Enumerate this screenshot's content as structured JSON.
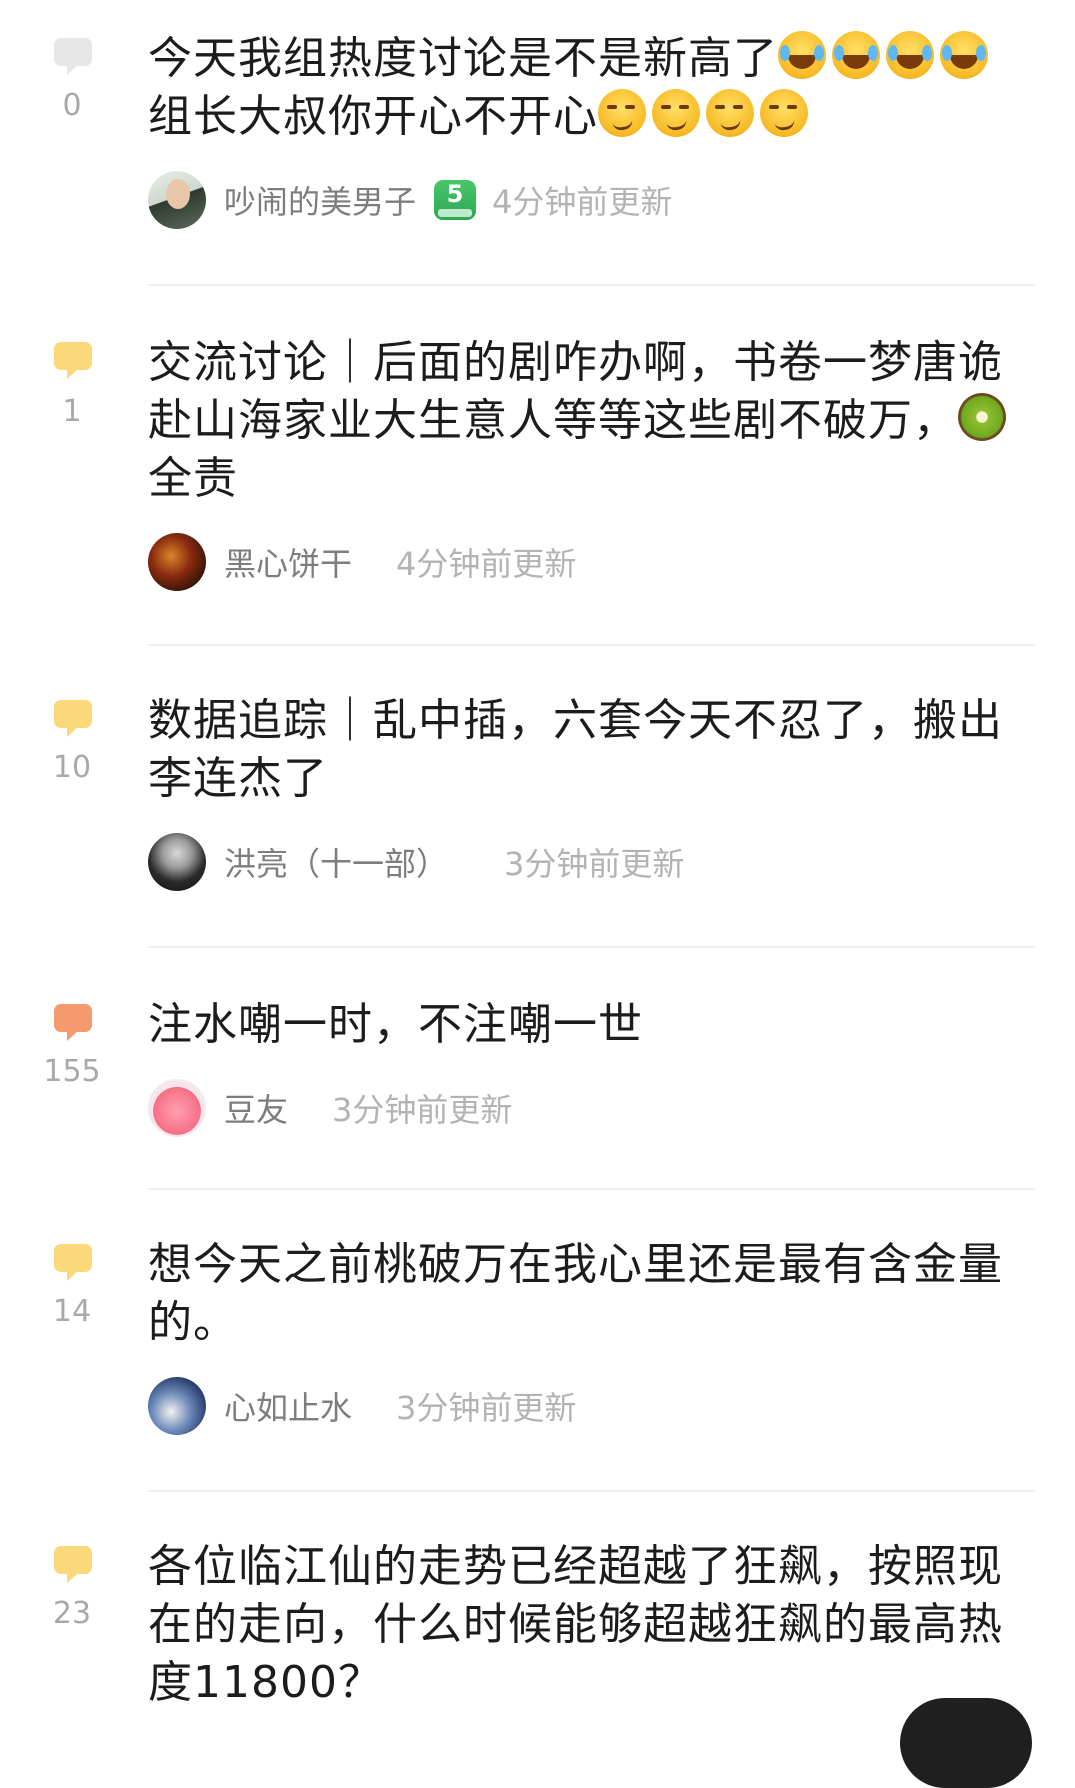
{
  "posts": [
    {
      "count": "0",
      "title": "今天我组热度讨论是不是新高了",
      "title2": "组长大叔你开心不开心",
      "author": "吵闹的美男子",
      "level": "5",
      "time": "4分钟前更新",
      "bubble_color": "#e6e6e6"
    },
    {
      "count": "1",
      "title": "交流讨论｜后面的剧咋办啊，书卷一梦唐诡赴山海家业大生意人等等这些剧不破万，",
      "title2": "全责",
      "author": "黑心饼干",
      "time": "4分钟前更新",
      "bubble_color": "#fbd97a"
    },
    {
      "count": "10",
      "title": "数据追踪｜乱中插，六套今天不忍了，搬出李连杰了",
      "author": "洪亮（十一部）",
      "time": "3分钟前更新",
      "bubble_color": "#fbd97a"
    },
    {
      "count": "155",
      "title": "注水嘲一时，不注嘲一世",
      "author": "豆友",
      "time": "3分钟前更新",
      "bubble_color": "#f59a6c"
    },
    {
      "count": "14",
      "title": "想今天之前桃破万在我心里还是最有含金量的。",
      "author": "心如止水",
      "time": "3分钟前更新",
      "bubble_color": "#fbd97a"
    },
    {
      "count": "23",
      "title": "各位临江仙的走势已经超越了狂飙，按照现在的走向，什么时候能够超越狂飙的最高热度11800？",
      "bubble_color": "#fbd97a"
    }
  ],
  "icons": {
    "comment": "comment-bubble-icon",
    "laugh": "tears-of-joy-emoji",
    "smirk": "smirk-emoji",
    "kiwi": "kiwi-emoji"
  }
}
